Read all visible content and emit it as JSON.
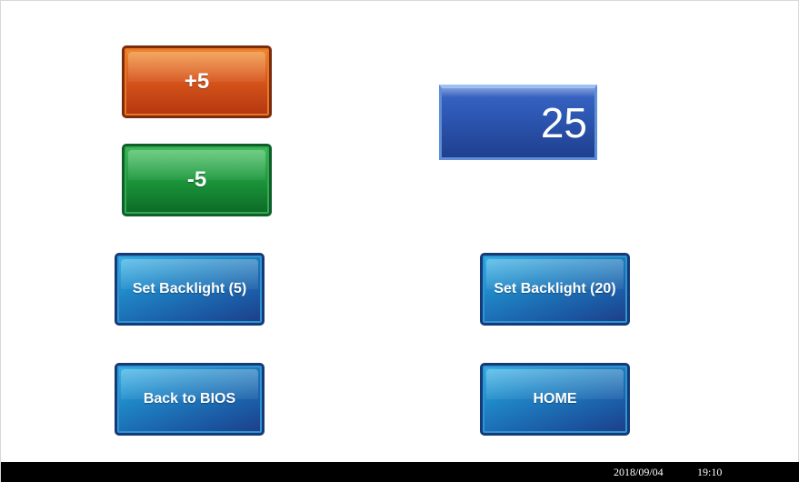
{
  "controls": {
    "increase_label": "+5",
    "decrease_label": "-5"
  },
  "display": {
    "value": "25"
  },
  "buttons": {
    "set_backlight_5": "Set Backlight (5)",
    "set_backlight_20": "Set Backlight (20)",
    "back_to_bios": "Back to BIOS",
    "home": "HOME"
  },
  "status_bar": {
    "date": "2018/09/04",
    "time": "19:10"
  },
  "colors": {
    "increase": "#d8571c",
    "decrease": "#1e9a3e",
    "nav_button": "#1f86c6",
    "value_box": "#2d57b3",
    "status_bar": "#000000"
  }
}
